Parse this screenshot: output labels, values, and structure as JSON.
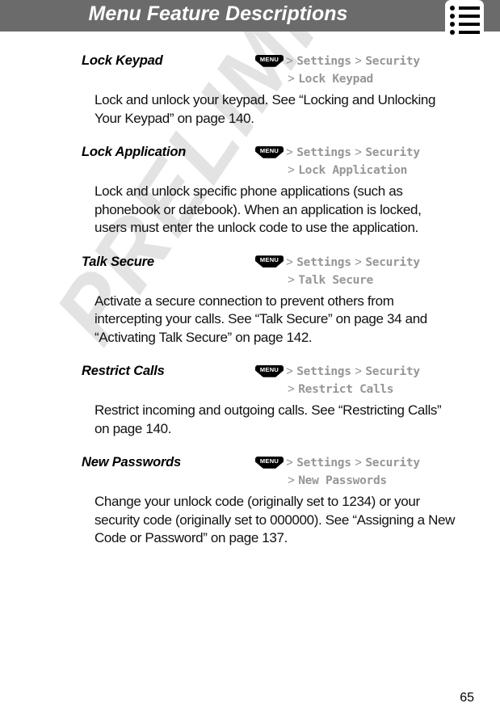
{
  "header": {
    "title": "Menu Feature Descriptions",
    "icon": "menu-list-icon",
    "bar_color": "#6b6b6b",
    "title_color": "#ffffff"
  },
  "watermark": {
    "text": "PRELIMINARY",
    "color": "#e3e3e3"
  },
  "menu_badge_label": "MENU",
  "separator": ">",
  "features": [
    {
      "title": "Lock Keypad",
      "path_line1": [
        "Settings",
        "Security"
      ],
      "path_line2": "Lock Keypad",
      "body": "Lock and unlock your keypad. See “Locking and Unlocking Your Keypad” on page 140."
    },
    {
      "title": "Lock Application",
      "path_line1": [
        "Settings",
        "Security"
      ],
      "path_line2": "Lock Application",
      "body": "Lock and unlock specific phone applications (such as phonebook or datebook). When an application is locked, users must enter the unlock code to use the application."
    },
    {
      "title": "Talk Secure",
      "path_line1": [
        "Settings",
        "Security"
      ],
      "path_line2": "Talk Secure",
      "body": "Activate a secure connection to prevent others from intercepting your calls. See “Talk Secure” on page 34 and “Activating Talk Secure” on page 142."
    },
    {
      "title": "Restrict Calls",
      "path_line1": [
        "Settings",
        "Security"
      ],
      "path_line2": "Restrict Calls",
      "body": "Restrict incoming and outgoing calls. See “Restricting Calls” on page 140."
    },
    {
      "title": "New Passwords",
      "path_line1": [
        "Settings",
        "Security"
      ],
      "path_line2": "New Passwords",
      "body": "Change your unlock code (originally set to 1234) or your security code (originally set to 000000). See “Assigning a New Code or Password” on page 137."
    }
  ],
  "footer": {
    "page_number": "65"
  }
}
